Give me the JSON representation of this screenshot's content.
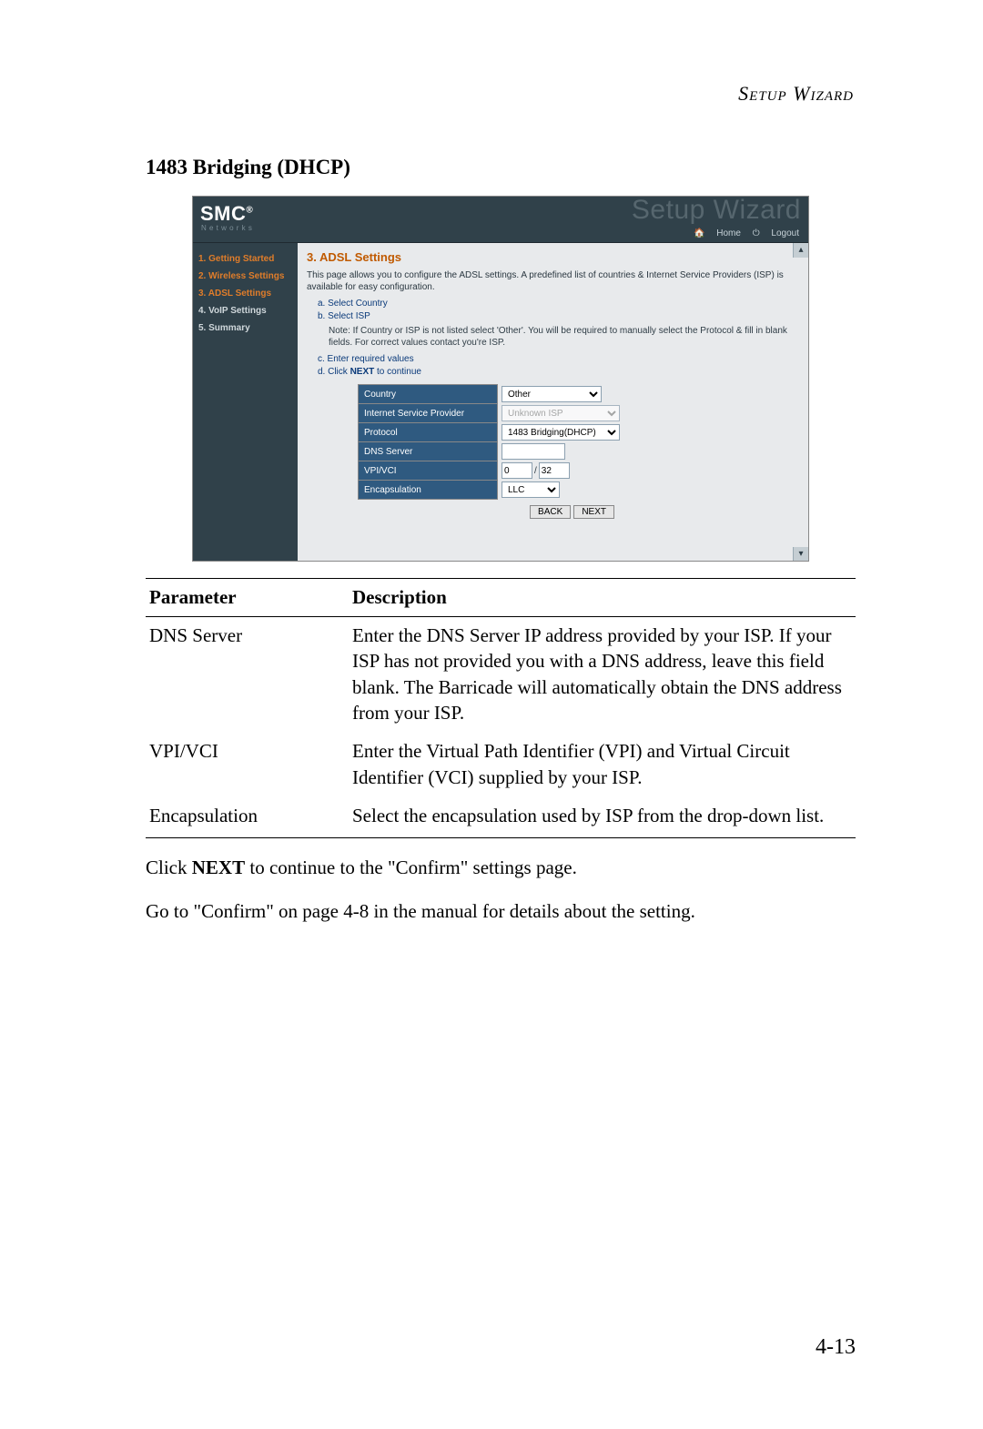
{
  "running_head": "Setup Wizard",
  "section_title": "1483 Bridging (DHCP)",
  "screenshot": {
    "logo_main": "SMC",
    "logo_sup": "®",
    "logo_sub": "N e t w o r k s",
    "wizard_ghost": "Setup Wizard",
    "home_link": "Home",
    "logout_link": "Logout",
    "sidebar": {
      "step1": "1. Getting Started",
      "step2": "2. Wireless Settings",
      "step3": "3. ADSL Settings",
      "step4": "4. VoIP Settings",
      "step5": "5. Summary"
    },
    "panel": {
      "heading": "3. ADSL Settings",
      "intro": "This page allows you to configure the ADSL settings. A predefined list of countries & Internet Service Providers (ISP) is available for easy configuration.",
      "step_a": "a.  Select Country",
      "step_b": "b.  Select ISP",
      "note": "Note: If Country or ISP is not listed select 'Other'. You will be required to manually select the Protocol & fill in blank fields. For correct values contact you're ISP.",
      "step_c": "c.  Enter required values",
      "step_d_prefix": "d.  Click ",
      "step_d_bold": "NEXT",
      "step_d_suffix": " to continue",
      "rows": {
        "country": "Country",
        "isp": "Internet Service Provider",
        "protocol": "Protocol",
        "dns": "DNS Server",
        "vpivci": "VPI/VCI",
        "encap": "Encapsulation"
      },
      "values": {
        "country": "Other",
        "isp": "Unknown ISP",
        "protocol": "1483 Bridging(DHCP)",
        "dns": "",
        "vpi": "0",
        "vci": "32",
        "encap": "LLC"
      },
      "back": "BACK",
      "next": "NEXT"
    }
  },
  "param_table": {
    "h1": "Parameter",
    "h2": "Description",
    "rows": {
      "r1p": "DNS Server",
      "r1d": "Enter the DNS Server IP address provided by your ISP. If your ISP has not provided you with a DNS address, leave this field blank. The Barricade will automatically obtain the DNS address from your ISP.",
      "r2p": "VPI/VCI",
      "r2d": "Enter the Virtual Path Identifier (VPI) and Virtual Circuit Identifier (VCI) supplied by your ISP.",
      "r3p": "Encapsulation",
      "r3d": "Select the encapsulation used by ISP from the drop-down list."
    }
  },
  "para1_pre": "Click ",
  "para1_bold": "NEXT",
  "para1_post": " to continue to the \"Confirm\" settings page.",
  "para2": "Go to \"Confirm\" on page 4-8 in the manual for details about the setting.",
  "page_number": "4-13"
}
